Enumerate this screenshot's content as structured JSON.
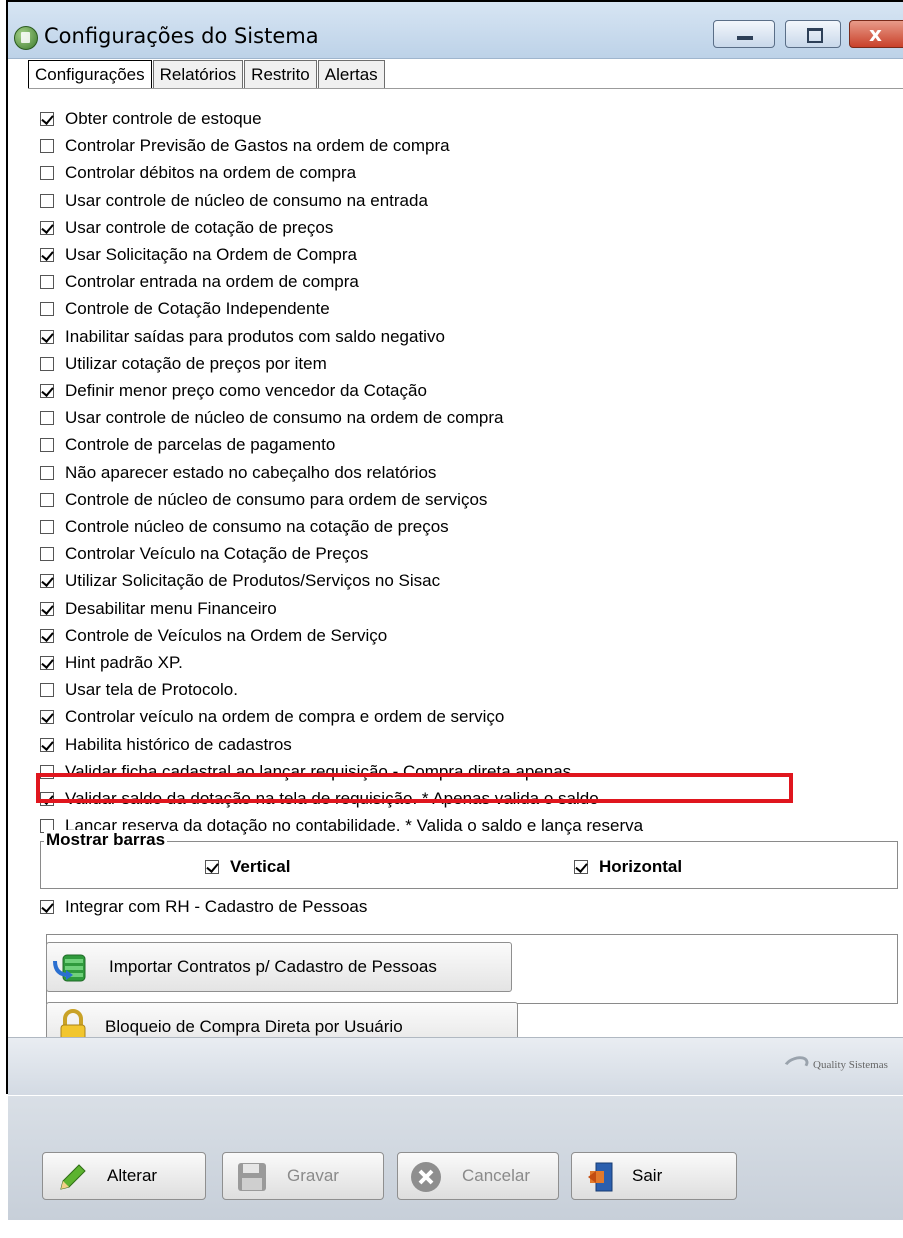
{
  "window": {
    "title": "Configurações do Sistema",
    "close_glyph": "x"
  },
  "tabs": [
    {
      "label": "Configurações",
      "active": true
    },
    {
      "label": "Relatórios",
      "active": false
    },
    {
      "label": "Restrito",
      "active": false
    },
    {
      "label": "Alertas",
      "active": false
    }
  ],
  "options": [
    {
      "label": "Obter controle de estoque",
      "checked": true
    },
    {
      "label": "Controlar Previsão de Gastos na ordem de compra",
      "checked": false
    },
    {
      "label": "Controlar débitos na ordem de compra",
      "checked": false
    },
    {
      "label": "Usar controle de núcleo de consumo na entrada",
      "checked": false
    },
    {
      "label": "Usar controle de cotação de preços",
      "checked": true
    },
    {
      "label": "Usar Solicitação na Ordem de Compra",
      "checked": true
    },
    {
      "label": "Controlar entrada na ordem de compra",
      "checked": false
    },
    {
      "label": "Controle de Cotação Independente",
      "checked": false
    },
    {
      "label": "Inabilitar saídas para produtos com saldo negativo",
      "checked": true
    },
    {
      "label": "Utilizar cotação de preços por item",
      "checked": false
    },
    {
      "label": "Definir menor preço como vencedor da Cotação",
      "checked": true
    },
    {
      "label": "Usar controle de núcleo de consumo na ordem de compra",
      "checked": false
    },
    {
      "label": "Controle de parcelas de pagamento",
      "checked": false
    },
    {
      "label": "Não aparecer estado no cabeçalho dos relatórios",
      "checked": false
    },
    {
      "label": "Controle de núcleo de consumo para ordem de serviços",
      "checked": false
    },
    {
      "label": "Controle núcleo de consumo na cotação de preços",
      "checked": false
    },
    {
      "label": "Controlar Veículo na Cotação de Preços",
      "checked": false
    },
    {
      "label": "Utilizar Solicitação de Produtos/Serviços no Sisac",
      "checked": true
    },
    {
      "label": "Desabilitar menu Financeiro",
      "checked": true
    },
    {
      "label": "Controle de Veículos na Ordem de Serviço",
      "checked": true
    },
    {
      "label": "Hint padrão XP.",
      "checked": true
    },
    {
      "label": "Usar tela de Protocolo.",
      "checked": false
    },
    {
      "label": "Controlar veículo na ordem de compra e ordem de serviço",
      "checked": true
    },
    {
      "label": "Habilita histórico de cadastros",
      "checked": true
    },
    {
      "label": "Validar ficha cadastral ao lançar requisição - Compra direta apenas",
      "checked": false
    },
    {
      "label": "Validar saldo da dotação na tela de requisição. * Apenas valida o saldo",
      "checked": true
    },
    {
      "label": "Lançar reserva da dotação no contabilidade. * Valida o saldo e lança reserva",
      "checked": false
    }
  ],
  "mostrar_barras": {
    "title": "Mostrar barras",
    "vertical": {
      "label": "Vertical",
      "checked": true
    },
    "horizontal": {
      "label": "Horizontal",
      "checked": true
    }
  },
  "rh": {
    "label": "Integrar com RH - Cadastro de Pessoas",
    "checked": true
  },
  "actions": {
    "import": "Importar Contratos p/ Cadastro de Pessoas",
    "block": "Bloqueio de Compra Direta por Usuário"
  },
  "brand": "Quality Sistemas",
  "buttons": {
    "alterar": "Alterar",
    "gravar": "Gravar",
    "cancelar": "Cancelar",
    "sair": "Sair"
  },
  "colors": {
    "highlight": "#e0161e"
  }
}
